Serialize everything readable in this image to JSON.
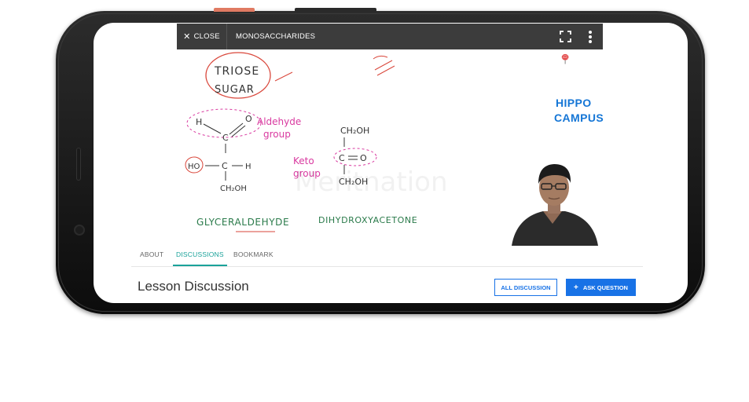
{
  "player": {
    "close_label": "CLOSE",
    "close_glyph": "✕",
    "lesson_title": "MONOSACCHARIDES",
    "fullscreen_icon": "fullscreen-icon",
    "more_icon": "more-vert-icon"
  },
  "video": {
    "logo_line1": "HIPPO",
    "logo_line2": "CAMPUS",
    "watermark": "Meritnation"
  },
  "tabs": [
    {
      "label": "ABOUT",
      "active": false
    },
    {
      "label": "DISCUSSIONS",
      "active": true
    },
    {
      "label": "BOOKMARK",
      "active": false
    }
  ],
  "discussion": {
    "title": "Lesson Discussion",
    "all_button": "ALL DISCUSSION",
    "ask_button": "ASK QUESTION",
    "ask_glyph": "+"
  },
  "colors": {
    "accent_blue": "#1872e6",
    "tab_active": "#1aa29a",
    "player_bar": "#3c3c3c",
    "logo_blue": "#1576d6"
  }
}
